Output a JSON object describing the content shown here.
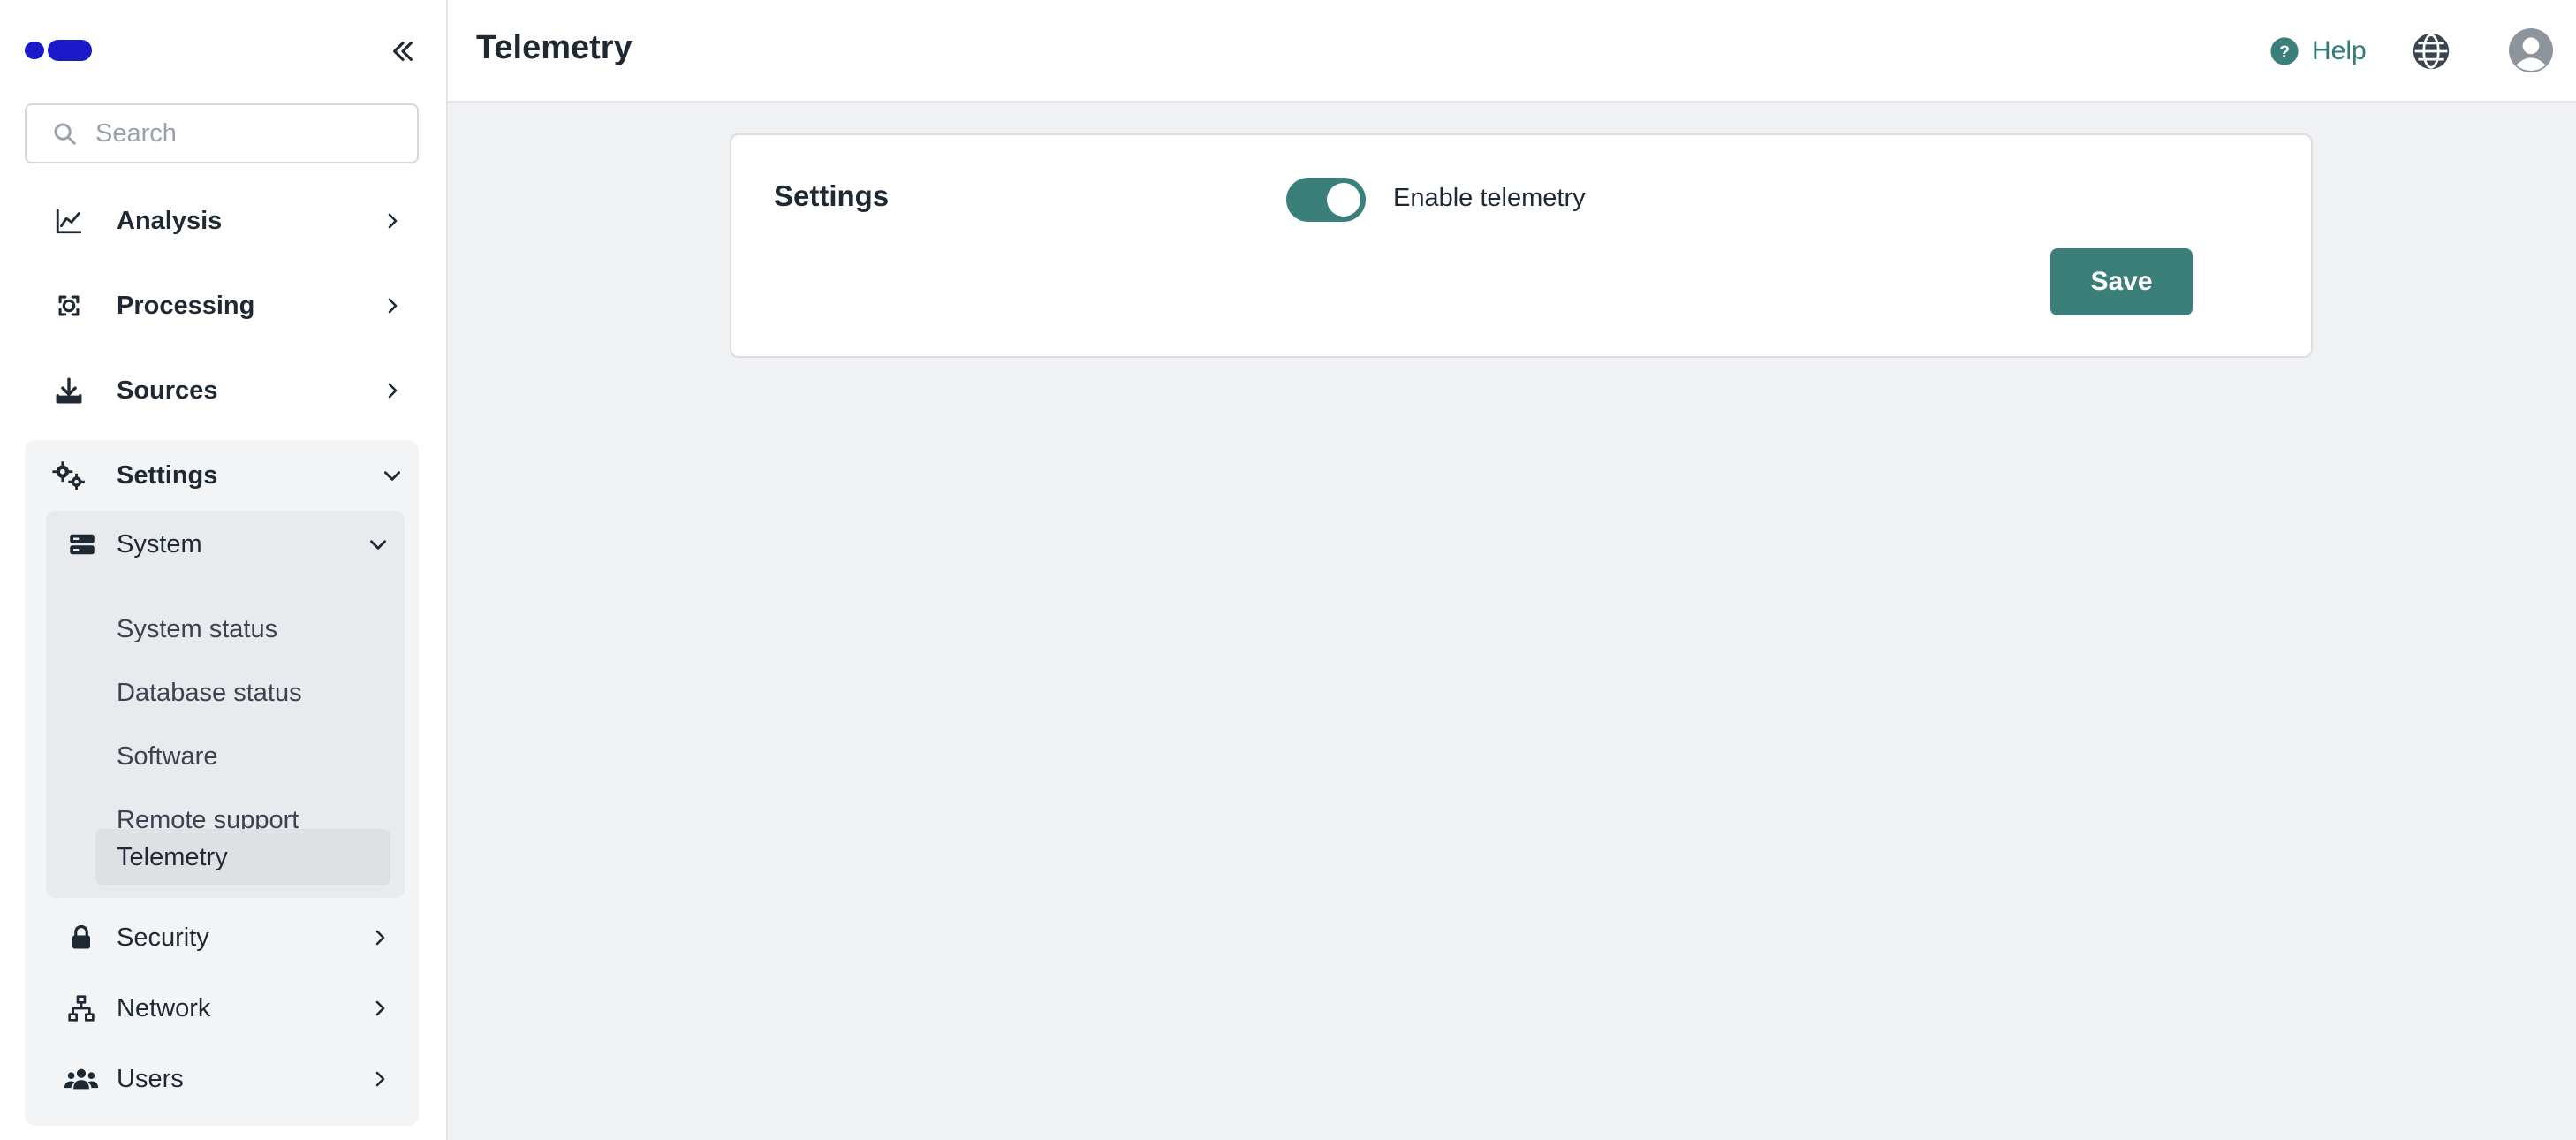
{
  "sidebar": {
    "search_placeholder": "Search",
    "nav": {
      "analysis": "Analysis",
      "processing": "Processing",
      "sources": "Sources",
      "settings": "Settings"
    },
    "settings_children": {
      "system": "System",
      "system_items": [
        "System status",
        "Database status",
        "Software",
        "Remote support",
        "Telemetry"
      ],
      "security": "Security",
      "network": "Network",
      "users": "Users"
    },
    "active_item": "Telemetry"
  },
  "header": {
    "title": "Telemetry",
    "help_label": "Help"
  },
  "main": {
    "card_title": "Settings",
    "toggle_label": "Enable telemetry",
    "toggle_on": true,
    "save_label": "Save"
  },
  "colors": {
    "accent": "#3b7f7b",
    "logo": "#1a1acb",
    "page_bg": "#f0f1f3"
  }
}
